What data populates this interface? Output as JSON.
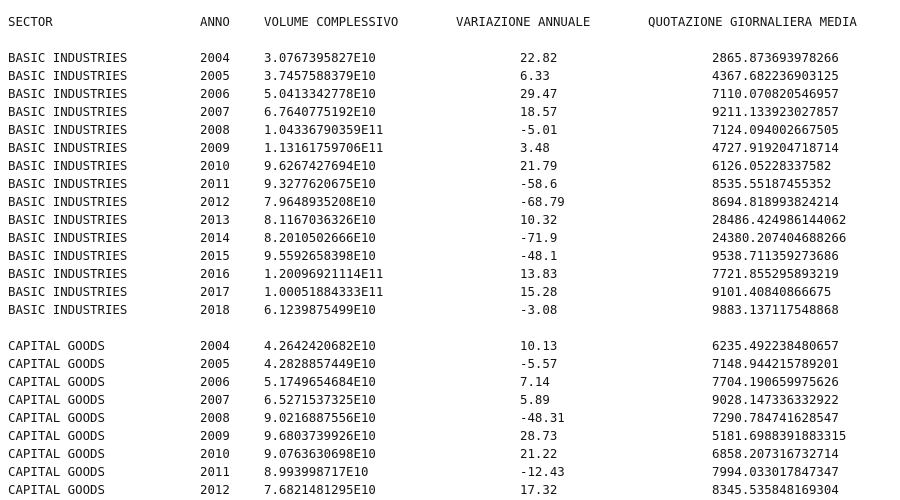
{
  "header": {
    "sector": "SECTOR",
    "anno": "ANNO",
    "volume": "VOLUME COMPLESSIVO",
    "variazione": "VARIAZIONE ANNUALE",
    "quotazione": "QUOTAZIONE GIORNALIERA MEDIA"
  },
  "groups": [
    {
      "rows": [
        {
          "sector": "BASIC INDUSTRIES",
          "anno": "2004",
          "volume": "3.0767395827E10",
          "variazione": "22.82",
          "quotazione": "2865.873693978266"
        },
        {
          "sector": "BASIC INDUSTRIES",
          "anno": "2005",
          "volume": "3.7457588379E10",
          "variazione": "6.33",
          "quotazione": "4367.682236903125"
        },
        {
          "sector": "BASIC INDUSTRIES",
          "anno": "2006",
          "volume": "5.0413342778E10",
          "variazione": "29.47",
          "quotazione": "7110.070820546957"
        },
        {
          "sector": "BASIC INDUSTRIES",
          "anno": "2007",
          "volume": "6.7640775192E10",
          "variazione": "18.57",
          "quotazione": "9211.133923027857"
        },
        {
          "sector": "BASIC INDUSTRIES",
          "anno": "2008",
          "volume": "1.04336790359E11",
          "variazione": "-5.01",
          "quotazione": "7124.094002667505"
        },
        {
          "sector": "BASIC INDUSTRIES",
          "anno": "2009",
          "volume": "1.13161759706E11",
          "variazione": "3.48",
          "quotazione": "4727.919204718714"
        },
        {
          "sector": "BASIC INDUSTRIES",
          "anno": "2010",
          "volume": "9.6267427694E10",
          "variazione": "21.79",
          "quotazione": "6126.05228337582"
        },
        {
          "sector": "BASIC INDUSTRIES",
          "anno": "2011",
          "volume": "9.3277620675E10",
          "variazione": "-58.6",
          "quotazione": "8535.55187455352"
        },
        {
          "sector": "BASIC INDUSTRIES",
          "anno": "2012",
          "volume": "7.9648935208E10",
          "variazione": "-68.79",
          "quotazione": "8694.818993824214"
        },
        {
          "sector": "BASIC INDUSTRIES",
          "anno": "2013",
          "volume": "8.1167036326E10",
          "variazione": "10.32",
          "quotazione": "28486.424986144062"
        },
        {
          "sector": "BASIC INDUSTRIES",
          "anno": "2014",
          "volume": "8.2010502666E10",
          "variazione": "-71.9",
          "quotazione": "24380.207404688266"
        },
        {
          "sector": "BASIC INDUSTRIES",
          "anno": "2015",
          "volume": "9.5592658398E10",
          "variazione": "-48.1",
          "quotazione": "9538.711359273686"
        },
        {
          "sector": "BASIC INDUSTRIES",
          "anno": "2016",
          "volume": "1.20096921114E11",
          "variazione": "13.83",
          "quotazione": "7721.855295893219"
        },
        {
          "sector": "BASIC INDUSTRIES",
          "anno": "2017",
          "volume": "1.00051884333E11",
          "variazione": "15.28",
          "quotazione": "9101.40840866675"
        },
        {
          "sector": "BASIC INDUSTRIES",
          "anno": "2018",
          "volume": "6.1239875499E10",
          "variazione": "-3.08",
          "quotazione": "9883.137117548868"
        }
      ]
    },
    {
      "rows": [
        {
          "sector": "CAPITAL GOODS",
          "anno": "2004",
          "volume": "4.2642420682E10",
          "variazione": "10.13",
          "quotazione": "6235.492238480657"
        },
        {
          "sector": "CAPITAL GOODS",
          "anno": "2005",
          "volume": "4.2828857449E10",
          "variazione": "-5.57",
          "quotazione": "7148.944215789201"
        },
        {
          "sector": "CAPITAL GOODS",
          "anno": "2006",
          "volume": "5.1749654684E10",
          "variazione": "7.14",
          "quotazione": "7704.190659975626"
        },
        {
          "sector": "CAPITAL GOODS",
          "anno": "2007",
          "volume": "6.5271537325E10",
          "variazione": "5.89",
          "quotazione": "9028.147336332922"
        },
        {
          "sector": "CAPITAL GOODS",
          "anno": "2008",
          "volume": "9.0216887556E10",
          "variazione": "-48.31",
          "quotazione": "7290.784741628547"
        },
        {
          "sector": "CAPITAL GOODS",
          "anno": "2009",
          "volume": "9.6803739926E10",
          "variazione": "28.73",
          "quotazione": "5181.6988391883315"
        },
        {
          "sector": "CAPITAL GOODS",
          "anno": "2010",
          "volume": "9.0763630698E10",
          "variazione": "21.22",
          "quotazione": "6858.207316732714"
        },
        {
          "sector": "CAPITAL GOODS",
          "anno": "2011",
          "volume": "8.993998717E10",
          "variazione": "-12.43",
          "quotazione": "7994.033017847347"
        },
        {
          "sector": "CAPITAL GOODS",
          "anno": "2012",
          "volume": "7.6821481295E10",
          "variazione": "17.32",
          "quotazione": "8345.535848169304"
        }
      ]
    }
  ]
}
